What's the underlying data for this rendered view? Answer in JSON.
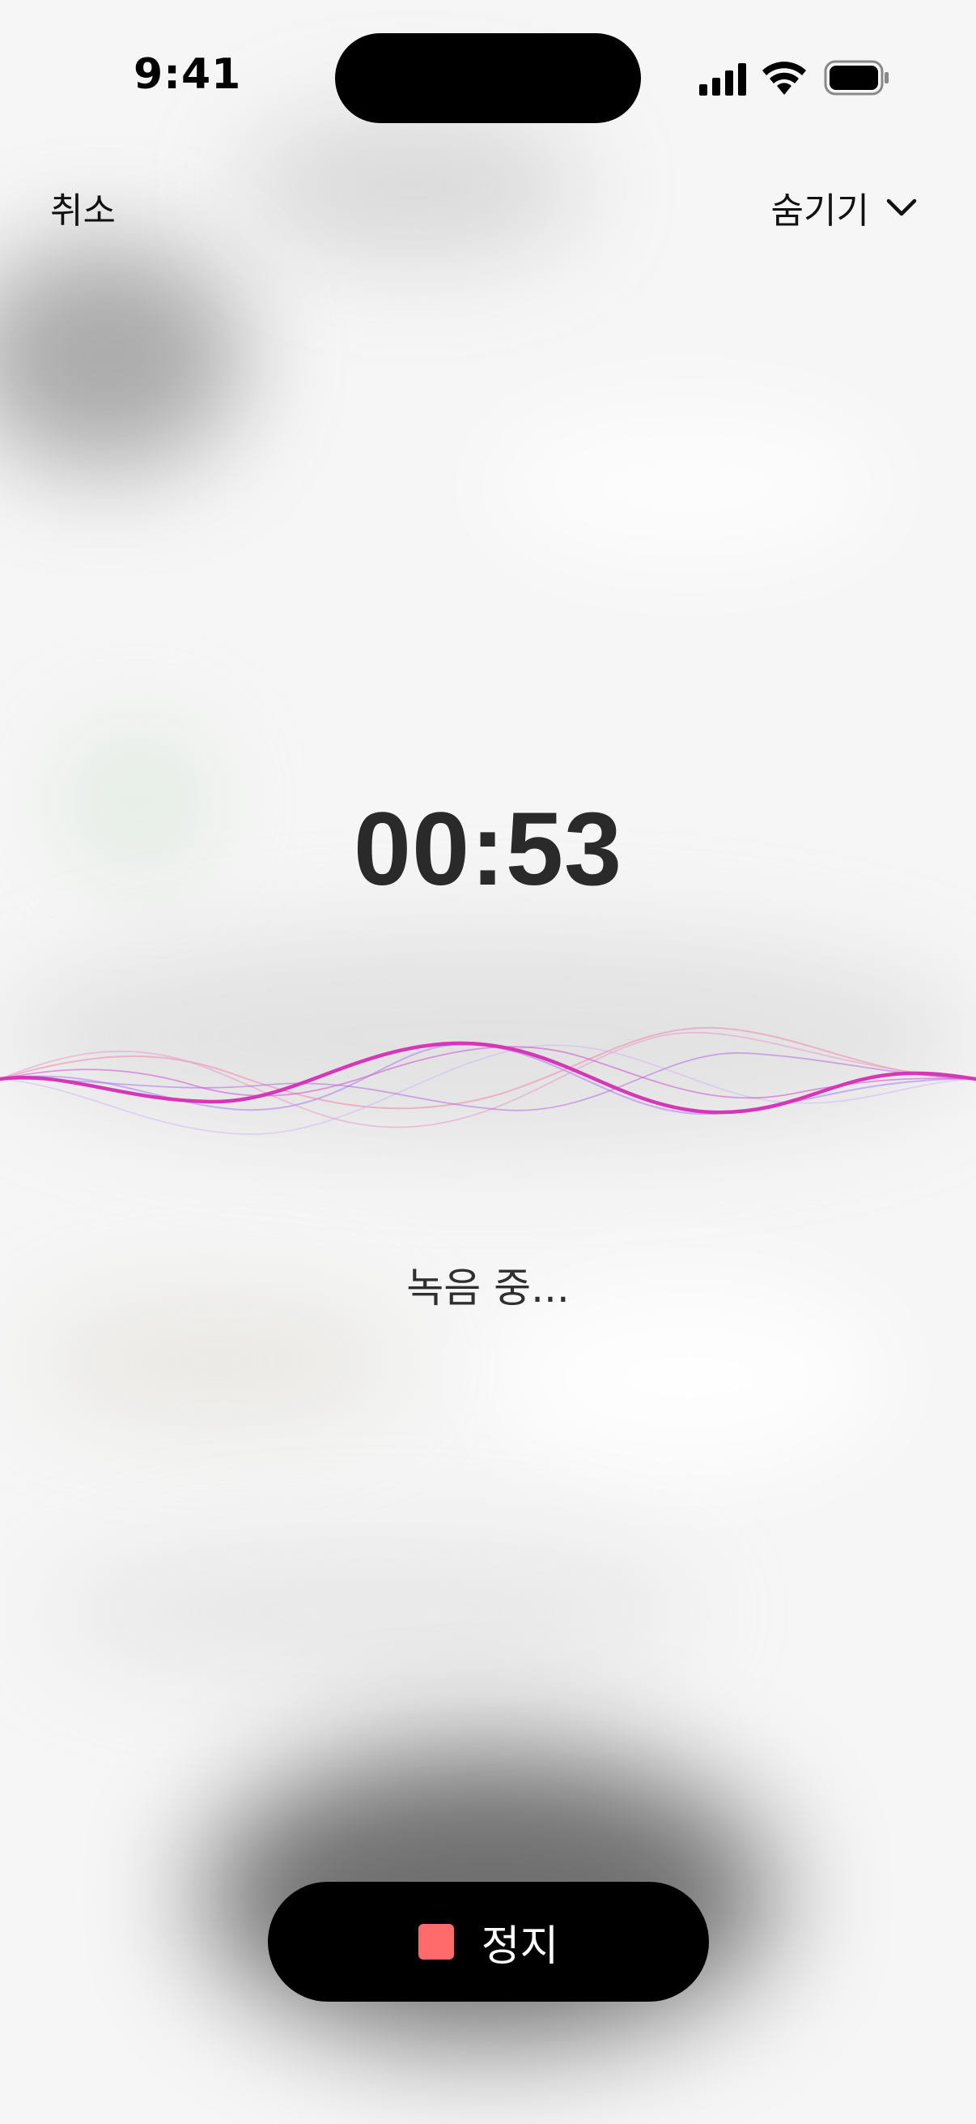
{
  "status_bar": {
    "time": "9:41"
  },
  "nav": {
    "cancel_label": "취소",
    "hide_label": "숨기기"
  },
  "recording": {
    "timer": "00:53",
    "status": "녹음 중..."
  },
  "controls": {
    "stop_label": "정지"
  },
  "colors": {
    "background": "#f6f6f6",
    "wave_primary": "#d636b8",
    "wave_secondary": "#a77cf0",
    "wave_tertiary": "#ee8fb0",
    "stop_icon": "#ff6b6b",
    "stop_button": "#000000"
  },
  "icons": {
    "signal": "cellular-signal-icon",
    "wifi": "wifi-icon",
    "battery": "battery-icon",
    "chevron": "chevron-down-icon",
    "stop": "stop-square-icon"
  }
}
